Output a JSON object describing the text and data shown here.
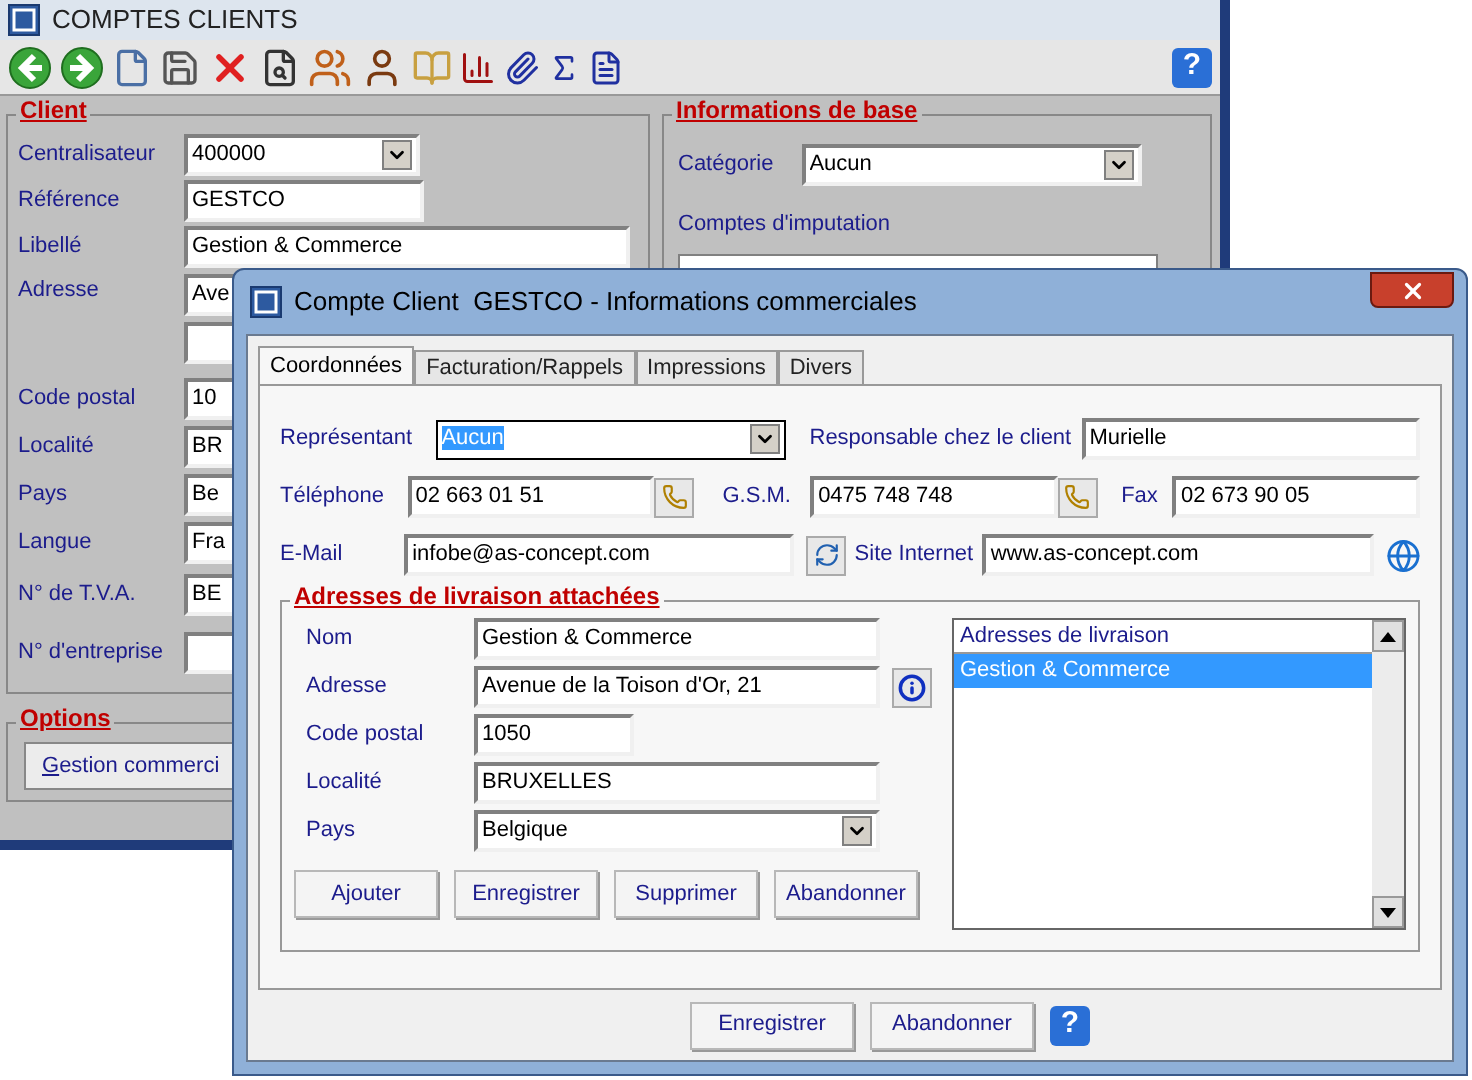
{
  "main_window": {
    "title": "COMPTES CLIENTS",
    "help": "?",
    "client": {
      "title": "Client",
      "fields": [
        {
          "label": "Centralisateur",
          "value": "400000",
          "kind": "dropdown"
        },
        {
          "label": "Référence",
          "value": "GESTCO",
          "kind": "short"
        },
        {
          "label": "Libellé",
          "value": "Gestion & Commerce",
          "kind": "long"
        },
        {
          "label": "Adresse",
          "value": "Ave",
          "kind": "address"
        },
        {
          "label": "Code postal",
          "value": "10",
          "kind": "hidden"
        },
        {
          "label": "Localité",
          "value": "BR",
          "kind": "hidden"
        },
        {
          "label": "Pays",
          "value": "Be",
          "kind": "hidden"
        },
        {
          "label": "Langue",
          "value": "Fra",
          "kind": "hidden"
        },
        {
          "label": "N° de T.V.A.",
          "value": "BE",
          "kind": "hidden"
        },
        {
          "label": "N° d'entreprise",
          "kind": "hidden"
        }
      ]
    },
    "base_info": {
      "title": "Informations de base",
      "category_label": "Catégorie",
      "category_value": "Aucun",
      "accounts_label": "Comptes d'imputation"
    },
    "options": {
      "title": "Options",
      "button": "Gestion commerci"
    }
  },
  "dialog": {
    "title": "Compte Client  GESTCO - Informations commerciales",
    "tabs": [
      {
        "label": "Coordonnées",
        "selected": true
      },
      {
        "label": "Facturation/Rappels",
        "selected": false
      },
      {
        "label": "Impressions",
        "selected": false
      },
      {
        "label": "Divers",
        "selected": false
      }
    ],
    "representative": {
      "label": "Représentant",
      "value": "Aucun"
    },
    "contact": {
      "label": "Responsable chez le client",
      "value": "Murielle"
    },
    "phone": {
      "label": "Téléphone",
      "value": "02 663 01 51"
    },
    "mobile": {
      "label": "G.S.M.",
      "value": "0475 748 748"
    },
    "fax": {
      "label": "Fax",
      "value": "02 673 90 05"
    },
    "email": {
      "label": "E-Mail",
      "value": "infobe@as-concept.com"
    },
    "website": {
      "label": "Site Internet",
      "value": "www.as-concept.com"
    },
    "delivery": {
      "title": "Adresses de livraison attachées",
      "fields": [
        {
          "label": "Nom",
          "value": "Gestion & Commerce",
          "kind": "text"
        },
        {
          "label": "Adresse",
          "value": "Avenue de la Toison d'Or, 21",
          "kind": "info"
        },
        {
          "label": "Code postal",
          "value": "1050",
          "kind": "short"
        },
        {
          "label": "Localité",
          "value": "BRUXELLES",
          "kind": "text"
        },
        {
          "label": "Pays",
          "value": "Belgique",
          "kind": "dropdown"
        }
      ],
      "buttons": [
        "Ajouter",
        "Enregistrer",
        "Supprimer",
        "Abandonner"
      ],
      "list_header": "Adresses de livraison",
      "list_items": [
        {
          "text": "Gestion & Commerce",
          "selected": true
        }
      ]
    },
    "buttons": [
      "Enregistrer",
      "Abandonner"
    ],
    "help": "?"
  }
}
